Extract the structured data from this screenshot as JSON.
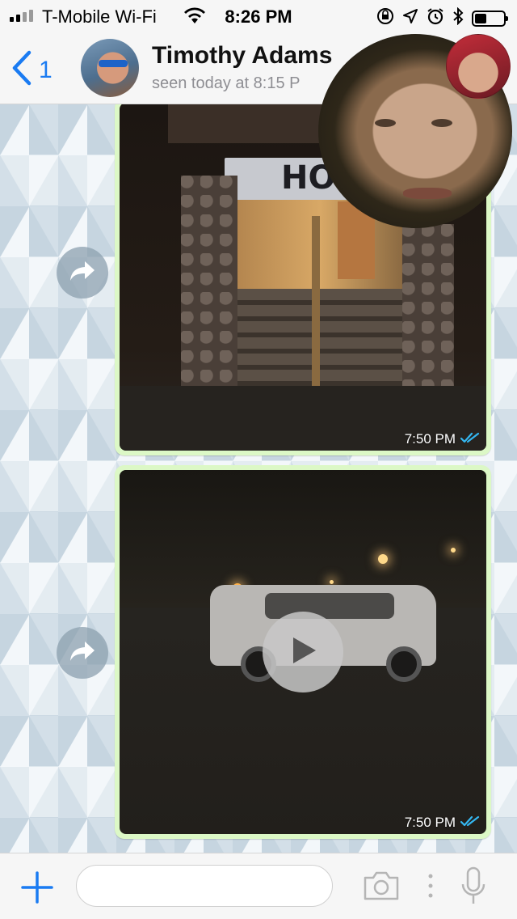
{
  "status_bar": {
    "carrier": "T-Mobile Wi-Fi",
    "time": "8:26 PM",
    "icons": [
      "signal-bars-icon",
      "wifi-icon",
      "rotation-lock-icon",
      "location-arrow-icon",
      "alarm-icon",
      "bluetooth-icon",
      "battery-icon"
    ]
  },
  "header": {
    "back_count": "1",
    "contact_name": "Timothy Adams",
    "contact_status": "seen today at 8:15 P"
  },
  "messages": [
    {
      "type": "photo",
      "image_text": "HO",
      "time": "7:50 PM",
      "status": "read",
      "forward_icon": "forward-arrow-icon"
    },
    {
      "type": "video",
      "time": "7:50 PM",
      "status": "read",
      "forward_icon": "forward-arrow-icon",
      "play_icon": "play-icon"
    }
  ],
  "video_call": {
    "remote_participant": "large-video-bubble",
    "self_view": "small-video-bubble"
  },
  "input_bar": {
    "placeholder": "",
    "icons": [
      "plus-icon",
      "camera-icon",
      "more-dots-icon",
      "microphone-icon"
    ]
  },
  "colors": {
    "accent": "#1a7bf2",
    "outgoing_bubble": "#dcf8c6",
    "read_ticks": "#34b7f1"
  }
}
